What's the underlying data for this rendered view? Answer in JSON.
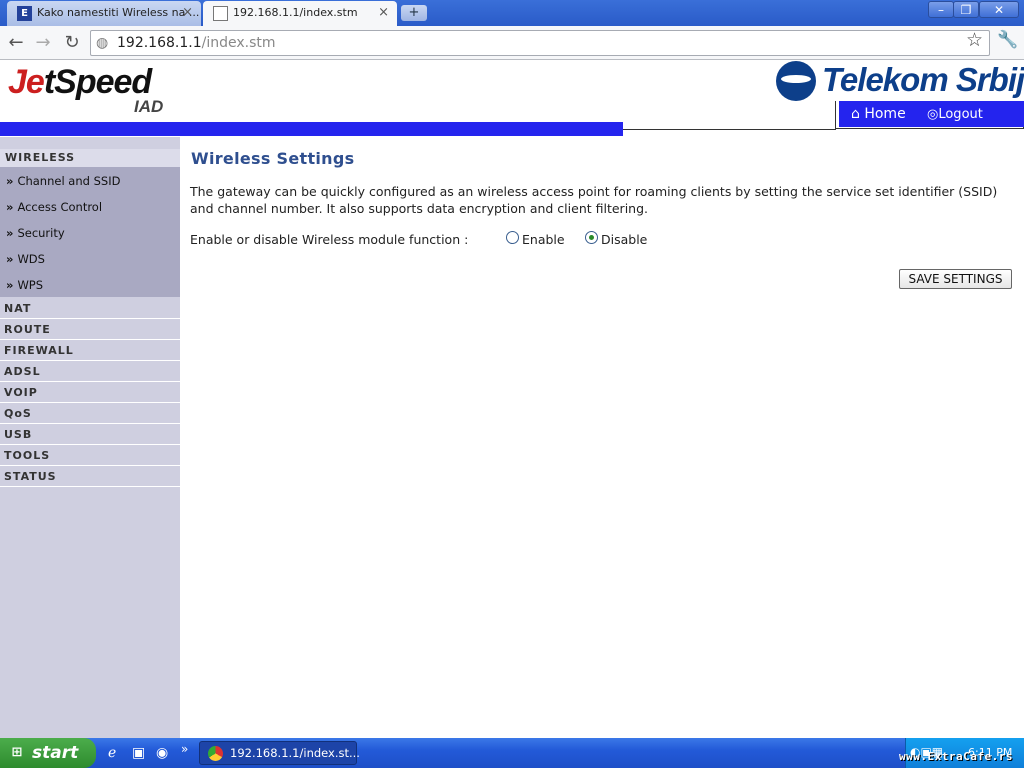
{
  "browser": {
    "tabs": [
      {
        "label": "Kako namestiti Wireless na ...",
        "favicon": "E"
      },
      {
        "label": "192.168.1.1/index.stm"
      }
    ],
    "newtab_glyph": "+",
    "url_host": "192.168.1.1",
    "url_path": "/index.stm",
    "close_glyph": "×"
  },
  "header": {
    "logo_left_red": "J",
    "logo_left_e": "e",
    "logo_left_rest": "tSpeed",
    "logo_left_sub": "IAD",
    "logo_right": "Telekom Srbija",
    "home": "Home",
    "logout": "Logout"
  },
  "sidebar": {
    "section": "WIRELESS",
    "subitems": [
      "Channel and SSID",
      "Access Control",
      "Security",
      "WDS",
      "WPS"
    ],
    "bullet": "»",
    "menu": [
      "NAT",
      "ROUTE",
      "FIREWALL",
      "ADSL",
      "VOIP",
      "QoS",
      "USB",
      "TOOLS",
      "STATUS"
    ]
  },
  "main": {
    "title": "Wireless Settings",
    "description": "The gateway can be quickly configured as an wireless access point for roaming clients by setting the service set identifier (SSID) and channel number. It also supports data encryption and client filtering.",
    "enable_label": "Enable or disable Wireless module function :",
    "options": [
      "Enable",
      "Disable"
    ],
    "selected": "Disable",
    "save_button": "SAVE SETTINGS"
  },
  "taskbar": {
    "start": "start",
    "task": "192.168.1.1/index.st...",
    "clock": "6:11 PM"
  },
  "watermark": "www.ExtraCafe.rs",
  "colors": {
    "band": "#2525ee",
    "title": "#2f4f8f",
    "sidebar": "#cfcfe0",
    "submenu": "#a9a9c2"
  }
}
